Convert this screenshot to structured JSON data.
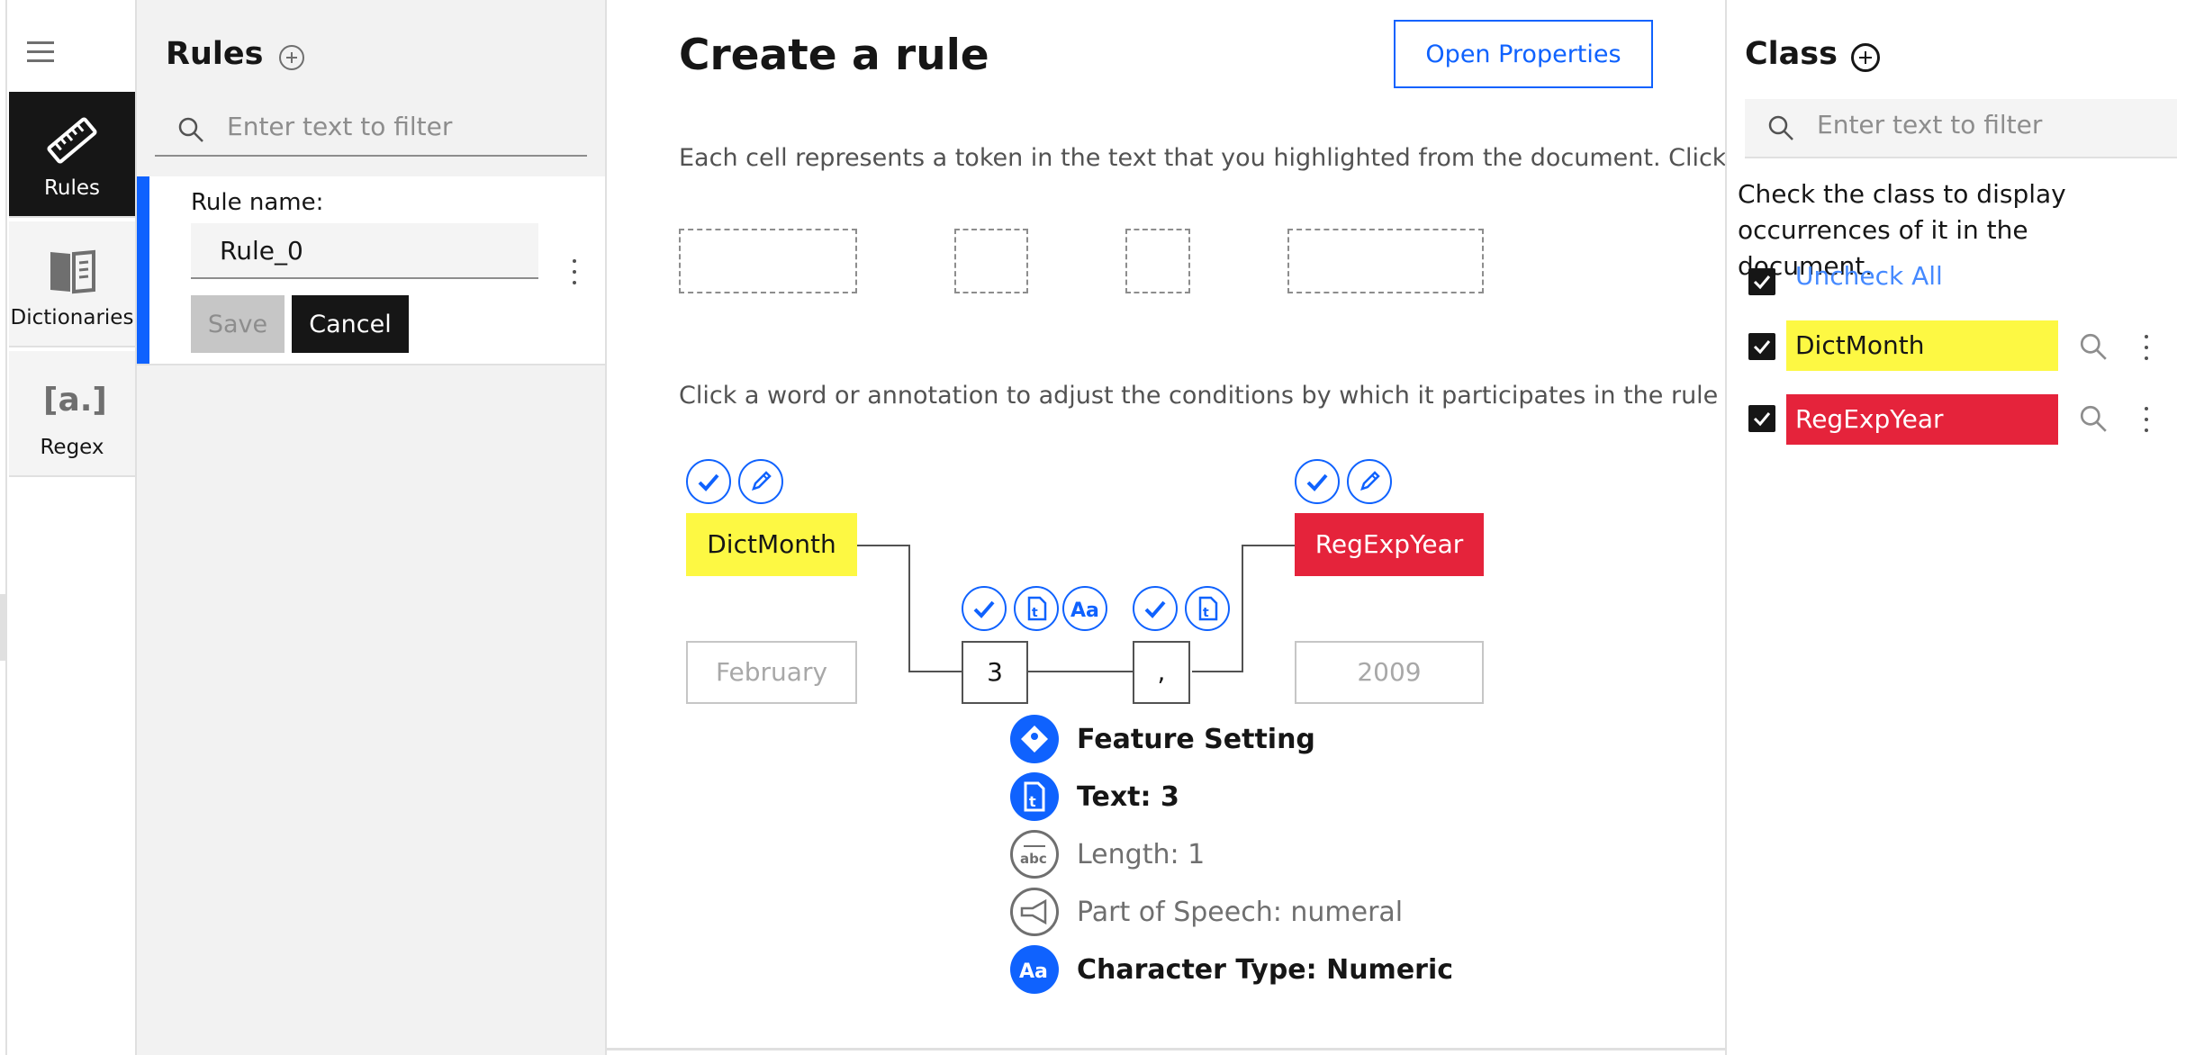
{
  "left_nav": {
    "items": [
      {
        "label": "Rules",
        "icon": "ruler-icon",
        "selected": true
      },
      {
        "label": "Dictionaries",
        "icon": "book-icon",
        "selected": false
      },
      {
        "label": "Regex",
        "icon": "regex-icon",
        "selected": false
      }
    ]
  },
  "rules_panel": {
    "title": "Rules",
    "filter_placeholder": "Enter text to filter",
    "rule_name_label": "Rule name:",
    "rule_name_value": "Rule_0",
    "save_label": "Save",
    "cancel_label": "Cancel"
  },
  "main": {
    "title": "Create a rule",
    "open_properties_label": "Open Properties",
    "intro_text": "Each cell represents a token in the text that you highlighted from the document. Click a cell",
    "instruction_text": "Click a word or annotation to adjust the conditions by which it participates in the rule pattern",
    "pattern": {
      "annotations": [
        "DictMonth",
        "RegExpYear"
      ],
      "words": [
        "February",
        "3",
        ",",
        "2009"
      ]
    },
    "features": [
      {
        "label": "Feature Setting",
        "icon": "feature-setting-icon",
        "active": true
      },
      {
        "label": "Text: 3",
        "icon": "text-icon",
        "active": true
      },
      {
        "label": "Length: 1",
        "icon": "length-icon",
        "active": false
      },
      {
        "label": "Part of Speech: numeral",
        "icon": "part-of-speech-icon",
        "active": false
      },
      {
        "label": "Character Type: Numeric",
        "icon": "character-type-icon",
        "active": true
      }
    ]
  },
  "class_panel": {
    "title": "Class",
    "filter_placeholder": "Enter text to filter",
    "help_text": "Check the class to display occurrences of it in the document.",
    "uncheck_all_label": "Uncheck All",
    "classes": [
      {
        "name": "DictMonth",
        "color": "#fdf843",
        "text_color": "#161616",
        "checked": true
      },
      {
        "name": "RegExpYear",
        "color": "#e5233b",
        "text_color": "#ffffff",
        "checked": true
      }
    ]
  },
  "colors": {
    "accent": "#0f62fe",
    "dict_month": "#fdf843",
    "regexp_year": "#e5233b",
    "selected_nav": "#161616"
  }
}
